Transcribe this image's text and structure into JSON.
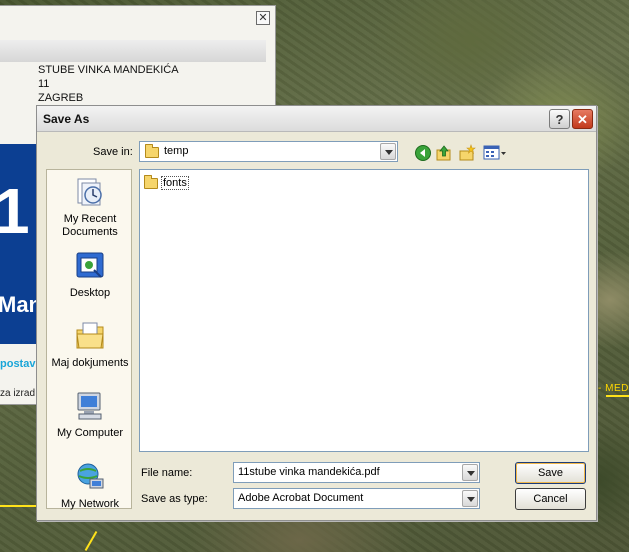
{
  "background_window": {
    "close_glyph": "✕",
    "address_lines": [
      "STUBE VINKA MANDEKIĆA",
      "11",
      "ZAGREB"
    ],
    "panel_number": "1",
    "panel_fragment": "Man",
    "link_fragment": "postav",
    "text_fragment": "za izrad"
  },
  "map": {
    "road_label": "- MED"
  },
  "dialog": {
    "title": "Save As",
    "help_glyph": "?",
    "close_glyph": "✕",
    "save_in_label": "Save in:",
    "save_in_value": "temp",
    "places": [
      {
        "label_line1": "My Recent",
        "label_line2": "Documents",
        "icon": "recent-documents-icon"
      },
      {
        "label_line1": "Desktop",
        "label_line2": "",
        "icon": "desktop-icon"
      },
      {
        "label_line1": "Maj dokjuments",
        "label_line2": "",
        "icon": "my-documents-icon"
      },
      {
        "label_line1": "My Computer",
        "label_line2": "",
        "icon": "my-computer-icon"
      },
      {
        "label_line1": "My Network",
        "label_line2": "",
        "icon": "my-network-icon"
      }
    ],
    "files": [
      {
        "name": "fonts",
        "type": "folder"
      }
    ],
    "file_name_label": "File name:",
    "file_name_value": "11stube vinka mandekića.pdf",
    "save_type_label": "Save as type:",
    "save_type_value": "Adobe Acrobat Document",
    "save_button": "Save",
    "cancel_button": "Cancel"
  },
  "colors": {
    "dialog_bg": "#ece9d8",
    "close_button": "#c23a1c",
    "panel_blue": "#0c3f92",
    "map_label": "#ffd800"
  }
}
